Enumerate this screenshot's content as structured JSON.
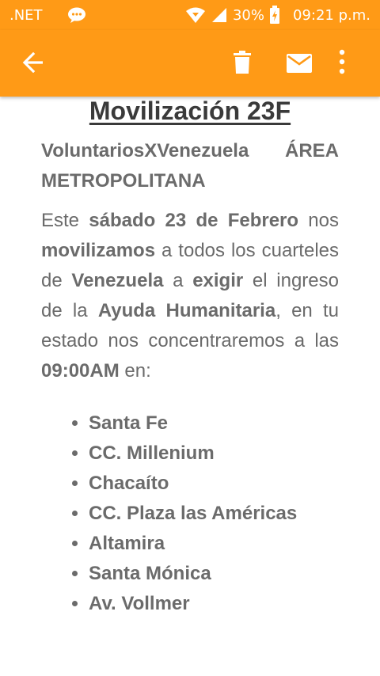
{
  "status_bar": {
    "network": ".NET",
    "battery": "30%",
    "time": "09:21 p.m."
  },
  "app_bar": {
    "icons": [
      "back-arrow-icon",
      "trash-icon",
      "mail-icon",
      "more-vert-icon"
    ]
  },
  "email": {
    "title": "Movilización 23F",
    "org": "VoluntariosXVenezuela ÁREA METROPOLITANA",
    "body": {
      "t1": "Este ",
      "b1": "sábado 23 de Febrero",
      "t2": " nos ",
      "b2": "movilizamos",
      "t3": " a todos los cuarteles de ",
      "b3": "Venezuela",
      "t4": " a ",
      "b4": "exigir",
      "t5": " el ingreso de la ",
      "b5": "Ayuda Humanitaria",
      "t6": ", en tu estado nos concentraremos a las ",
      "b6": "09:00AM",
      "t7": " en:"
    },
    "locations": [
      "Santa Fe",
      "CC. Millenium",
      "Chacaíto",
      "CC. Plaza las Américas",
      "Altamira",
      "Santa Mónica",
      "Av. Vollmer"
    ]
  }
}
